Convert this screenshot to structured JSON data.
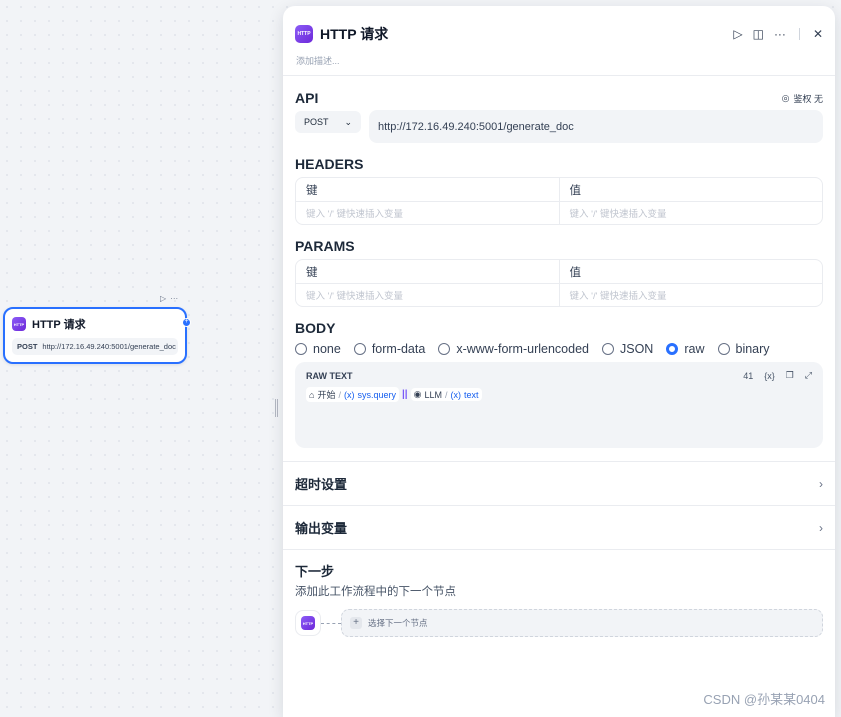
{
  "colors": {
    "accent": "#2970ff",
    "node_icon": "#7c3aed",
    "panel_bg": "#ffffff",
    "canvas_bg": "#f2f4f7"
  },
  "canvas_node": {
    "toolbar": {
      "run_icon": "play-icon",
      "more_icon": "more-icon"
    },
    "icon_text": "HTTP",
    "title": "HTTP 请求",
    "method": "POST",
    "url": "http://172.16.49.240:5001/generate_doc"
  },
  "panel": {
    "icon_text": "HTTP",
    "title": "HTTP 请求",
    "actions": [
      "play-icon",
      "book-icon",
      "more-icon",
      "close-icon"
    ],
    "description_placeholder": "添加描述...",
    "api": {
      "label": "API",
      "auth_label": "鉴权 无",
      "method": "POST",
      "url": "http://172.16.49.240:5001/generate_doc"
    },
    "headers": {
      "label": "HEADERS",
      "key_header": "键",
      "value_header": "值",
      "key_placeholder": "键入 '/' 键快速插入变量",
      "value_placeholder": "键入 '/' 键快速插入变量"
    },
    "params": {
      "label": "PARAMS",
      "key_header": "键",
      "value_header": "值",
      "key_placeholder": "键入 '/' 键快速插入变量",
      "value_placeholder": "键入 '/' 键快速插入变量"
    },
    "body": {
      "label": "BODY",
      "options": [
        "none",
        "form-data",
        "x-www-form-urlencoded",
        "JSON",
        "raw",
        "binary"
      ],
      "selected": "raw",
      "raw_label": "RAW TEXT",
      "char_count": "41",
      "var1": {
        "node": "开始",
        "var_prefix": "(x)",
        "var": "sys.query"
      },
      "separator": "||",
      "var2": {
        "node": "LLM",
        "var_prefix": "(x)",
        "var": "text"
      }
    },
    "timeout_label": "超时设置",
    "output_label": "输出变量",
    "next_step": {
      "title": "下一步",
      "subtitle": "添加此工作流程中的下一个节点",
      "select_placeholder": "选择下一个节点"
    }
  },
  "watermark": "CSDN @孙某某0404"
}
